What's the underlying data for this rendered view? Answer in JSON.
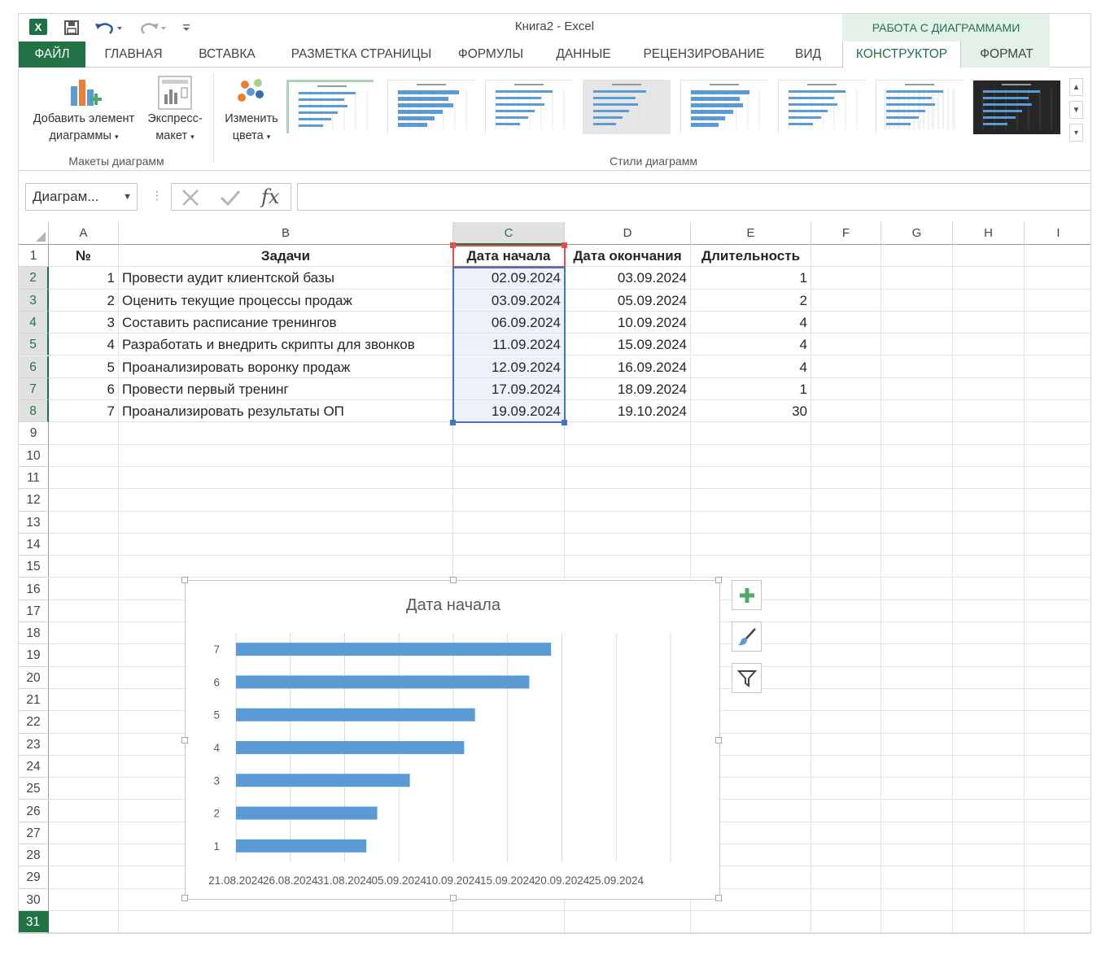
{
  "window": {
    "title": "Книга2 - Excel",
    "contextual_header": "РАБОТА С ДИАГРАММАМИ"
  },
  "tabs": [
    "ФАЙЛ",
    "ГЛАВНАЯ",
    "ВСТАВКА",
    "РАЗМЕТКА СТРАНИЦЫ",
    "ФОРМУЛЫ",
    "ДАННЫЕ",
    "РЕЦЕНЗИРОВАНИЕ",
    "ВИД",
    "КОНСТРУКТОР",
    "ФОРМАТ"
  ],
  "active_tab": "КОНСТРУКТОР",
  "ribbon": {
    "add_element": {
      "line1": "Добавить элемент",
      "line2": "диаграммы"
    },
    "quick_layout": {
      "line1": "Экспресс-",
      "line2": "макет"
    },
    "change_colors": {
      "line1": "Изменить",
      "line2": "цвета"
    },
    "group_layouts": "Макеты диаграмм",
    "group_styles": "Стили диаграмм"
  },
  "formula_bar": {
    "name_box": "Диаграм...",
    "fx": "fx",
    "value": ""
  },
  "columns": [
    "A",
    "B",
    "C",
    "D",
    "E",
    "F",
    "G",
    "H",
    "I"
  ],
  "rows": [
    "1",
    "2",
    "3",
    "4",
    "5",
    "6",
    "7",
    "8",
    "9",
    "10",
    "11",
    "12",
    "13",
    "14",
    "15",
    "16",
    "17",
    "18",
    "19",
    "20",
    "21",
    "22",
    "23",
    "24",
    "25",
    "26",
    "27",
    "28",
    "29",
    "30",
    "31"
  ],
  "table": {
    "headers": [
      "№",
      "Задачи",
      "Дата начала",
      "Дата окончания",
      "Длительность"
    ],
    "rows": [
      [
        "1",
        "Провести аудит клиентской базы",
        "02.09.2024",
        "03.09.2024",
        "1"
      ],
      [
        "2",
        "Оценить текущие процессы продаж",
        "03.09.2024",
        "05.09.2024",
        "2"
      ],
      [
        "3",
        "Составить расписание тренингов",
        "06.09.2024",
        "10.09.2024",
        "4"
      ],
      [
        "4",
        "Разработать и внедрить скрипты для звонков",
        "11.09.2024",
        "15.09.2024",
        "4"
      ],
      [
        "5",
        "Проанализировать воронку продаж",
        "12.09.2024",
        "16.09.2024",
        "4"
      ],
      [
        "6",
        "Провести первый тренинг",
        "17.09.2024",
        "18.09.2024",
        "1"
      ],
      [
        "7",
        "Проанализировать результаты ОП",
        "19.09.2024",
        "19.10.2024",
        "30"
      ]
    ]
  },
  "chart_data": {
    "type": "bar",
    "orientation": "horizontal",
    "title": "Дата начала",
    "categories": [
      "1",
      "2",
      "3",
      "4",
      "5",
      "6",
      "7"
    ],
    "values": [
      "2024-09-02",
      "2024-09-03",
      "2024-09-06",
      "2024-09-11",
      "2024-09-12",
      "2024-09-17",
      "2024-09-19"
    ],
    "xlim": [
      "2024-08-21",
      "2024-09-30"
    ],
    "x_ticks": [
      "21.08.2024",
      "26.08.2024",
      "31.08.2024",
      "05.09.2024",
      "10.09.2024",
      "15.09.2024",
      "20.09.2024",
      "25.09.2024"
    ],
    "grid": true,
    "legend": "none",
    "bar_color": "#5b9bd5"
  },
  "colors": {
    "accent": "#217346",
    "selection": "#4472c4",
    "series_highlight": "#e05050"
  }
}
